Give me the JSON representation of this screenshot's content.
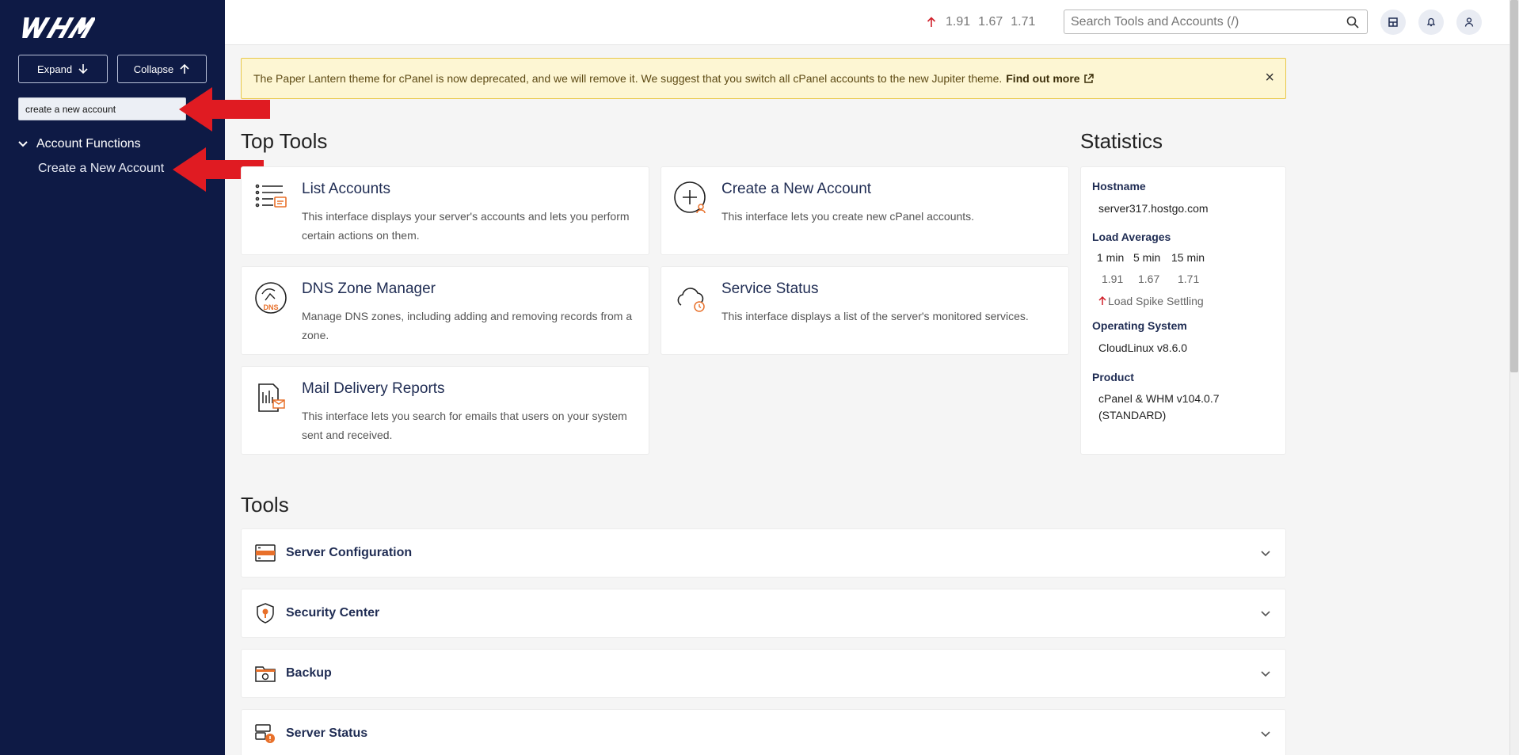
{
  "sidebar": {
    "expand_label": "Expand",
    "collapse_label": "Collapse",
    "search_value": "create a new account",
    "group_label": "Account Functions",
    "link_label": "Create a New Account"
  },
  "header": {
    "loads": [
      "1.91",
      "1.67",
      "1.71"
    ],
    "search_placeholder": "Search Tools and Accounts (/)"
  },
  "notice": {
    "text": "The Paper Lantern theme for cPanel is now deprecated, and we will remove it. We suggest that you switch all cPanel accounts to the new Jupiter theme.",
    "link_label": "Find out more",
    "close": "×"
  },
  "top_tools": {
    "heading": "Top Tools",
    "items": [
      {
        "title": "List Accounts",
        "desc": "This interface displays your server's accounts and lets you perform certain actions on them."
      },
      {
        "title": "Create a New Account",
        "desc": "This interface lets you create new cPanel accounts."
      },
      {
        "title": "DNS Zone Manager",
        "desc": "Manage DNS zones, including adding and removing records from a zone."
      },
      {
        "title": "Service Status",
        "desc": "This interface displays a list of the server's monitored services."
      },
      {
        "title": "Mail Delivery Reports",
        "desc": "This interface lets you search for emails that users on your system sent and received."
      }
    ]
  },
  "statistics": {
    "heading": "Statistics",
    "hostname_label": "Hostname",
    "hostname": "server317.hostgo.com",
    "load_label": "Load Averages",
    "load_headers": [
      "1 min",
      "5 min",
      "15 min"
    ],
    "load_values": [
      "1.91",
      "1.67",
      "1.71"
    ],
    "load_status": "Load Spike Settling",
    "os_label": "Operating System",
    "os": "CloudLinux v8.6.0",
    "product_label": "Product",
    "product_line1": "cPanel & WHM v104.0.7",
    "product_line2": "(STANDARD)"
  },
  "tools": {
    "heading": "Tools",
    "sections": [
      "Server Configuration",
      "Security Center",
      "Backup",
      "Server Status"
    ]
  },
  "icons": {
    "dns_badge": "DNS"
  },
  "colors": {
    "sidebar_bg": "#0e1a45",
    "accent_orange": "#e8702a",
    "notice_bg": "#fdf6d3",
    "arrow_red": "#e01b22",
    "load_up_red": "#d0202a"
  }
}
